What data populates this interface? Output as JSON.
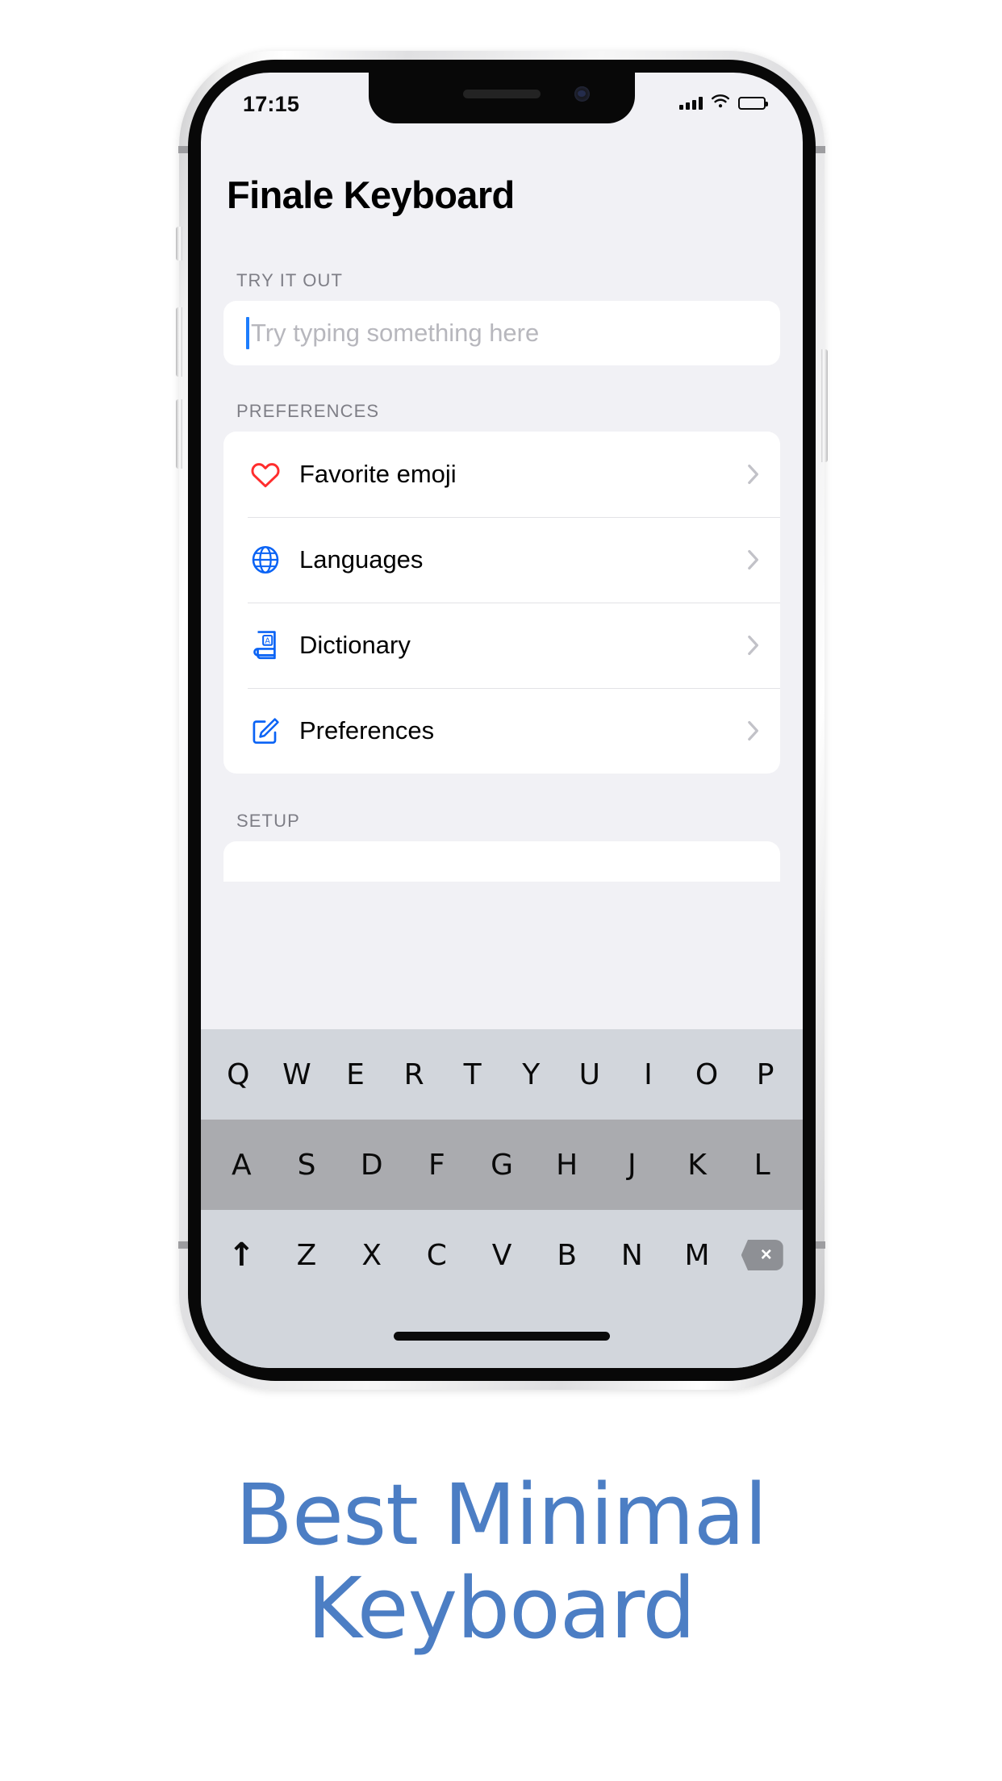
{
  "status_bar": {
    "time": "17:15",
    "signal_icon": "cellular-signal-icon",
    "signal_bars": 4,
    "wifi_icon": "wifi-icon",
    "battery_icon": "battery-icon",
    "battery_level_pct": 82
  },
  "app": {
    "title": "Finale Keyboard",
    "sections": {
      "try_it_out": {
        "label": "TRY IT OUT",
        "input_placeholder": "Try typing something here",
        "input_value": "",
        "caret_color": "#1d7dfd"
      },
      "preferences": {
        "label": "PREFERENCES",
        "rows": [
          {
            "label": "Favorite emoji",
            "icon": "heart-icon",
            "icon_color": "#ff2d2d",
            "chevron": "chevron-right-icon"
          },
          {
            "label": "Languages",
            "icon": "globe-icon",
            "icon_color": "#0a63f5",
            "chevron": "chevron-right-icon"
          },
          {
            "label": "Dictionary",
            "icon": "book-a-icon",
            "icon_color": "#0a63f5",
            "chevron": "chevron-right-icon"
          },
          {
            "label": "Preferences",
            "icon": "pencil-square-icon",
            "icon_color": "#0a63f5",
            "chevron": "chevron-right-icon"
          }
        ]
      },
      "setup": {
        "label": "SETUP"
      }
    }
  },
  "keyboard": {
    "row1": [
      "Q",
      "W",
      "E",
      "R",
      "T",
      "Y",
      "U",
      "I",
      "O",
      "P"
    ],
    "row2": [
      "A",
      "S",
      "D",
      "F",
      "G",
      "H",
      "J",
      "K",
      "L"
    ],
    "row3_letters": [
      "Z",
      "X",
      "C",
      "V",
      "B",
      "N",
      "M"
    ],
    "shift_key": "↑",
    "backspace_key": "×",
    "shift_icon": "shift-arrow-up-icon",
    "backspace_icon": "backspace-delete-icon",
    "bg_color": "#d2d6dc",
    "mid_row_bg_color": "#aaabaf"
  },
  "caption": {
    "line1": "Best Minimal",
    "line2": "Keyboard",
    "color": "#4c7ec4"
  }
}
